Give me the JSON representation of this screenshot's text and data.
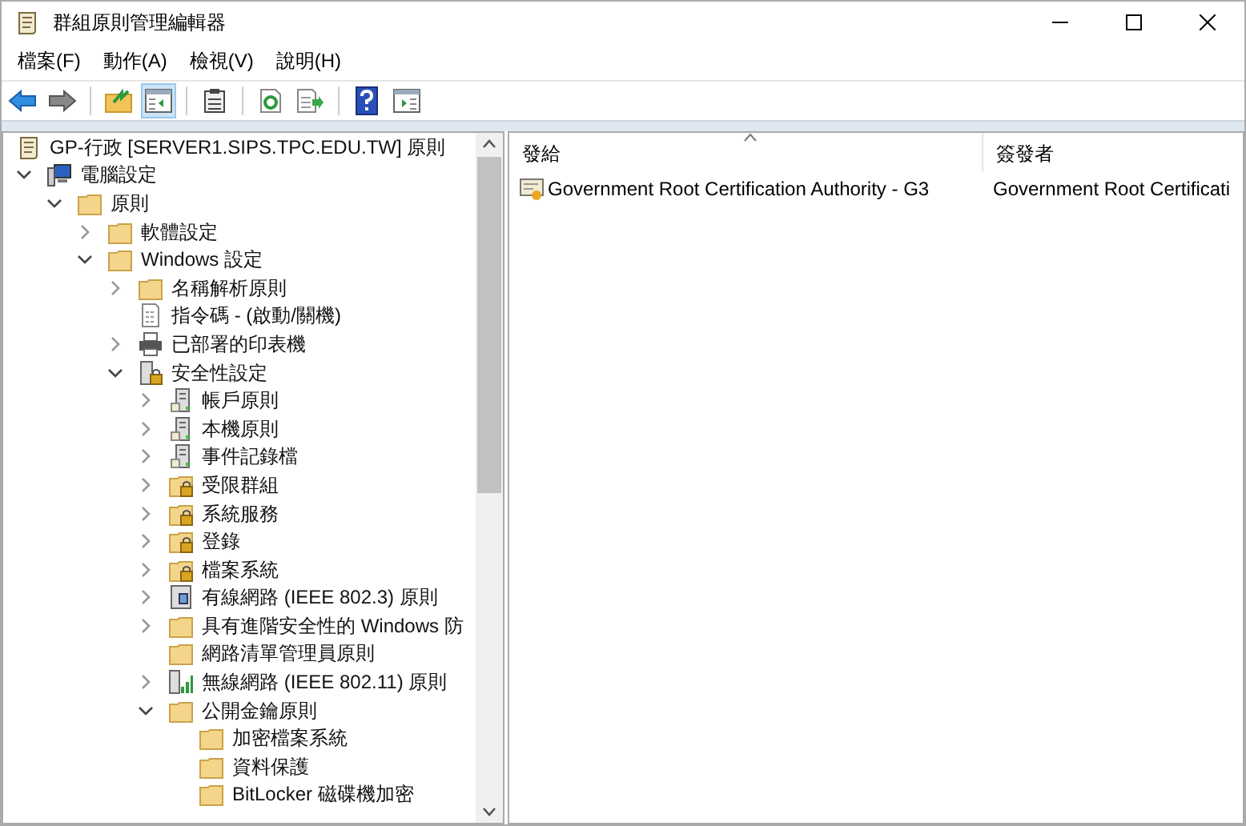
{
  "window": {
    "title": "群組原則管理編輯器"
  },
  "menu": [
    "檔案(F)",
    "動作(A)",
    "檢視(V)",
    "說明(H)"
  ],
  "toolbar": [
    {
      "kind": "back",
      "selected": false
    },
    {
      "kind": "forward",
      "selected": false
    },
    {
      "kind": "sep"
    },
    {
      "kind": "up",
      "selected": false
    },
    {
      "kind": "tree",
      "selected": true
    },
    {
      "kind": "sep"
    },
    {
      "kind": "clipboard",
      "selected": false
    },
    {
      "kind": "sep"
    },
    {
      "kind": "refresh",
      "selected": false
    },
    {
      "kind": "export",
      "selected": false
    },
    {
      "kind": "sep"
    },
    {
      "kind": "help",
      "selected": false
    },
    {
      "kind": "pane",
      "selected": false
    }
  ],
  "tree": {
    "label": "GP-行政 [SERVER1.SIPS.TPC.EDU.TW] 原則",
    "kind": "policy",
    "children": [
      {
        "label": "電腦設定",
        "kind": "computer",
        "expanded": true,
        "children": [
          {
            "label": "原則",
            "kind": "folder",
            "expanded": true,
            "children": [
              {
                "label": "軟體設定",
                "kind": "folder",
                "expanded": false
              },
              {
                "label": "Windows 設定",
                "kind": "folder",
                "expanded": true,
                "children": [
                  {
                    "label": "名稱解析原則",
                    "kind": "folder",
                    "expanded": false
                  },
                  {
                    "label": "指令碼 - (啟動/關機)",
                    "kind": "script"
                  },
                  {
                    "label": "已部署的印表機",
                    "kind": "printer",
                    "expanded": false
                  },
                  {
                    "label": "安全性設定",
                    "kind": "security",
                    "expanded": true,
                    "children": [
                      {
                        "label": "帳戶原則",
                        "kind": "server",
                        "expanded": false
                      },
                      {
                        "label": "本機原則",
                        "kind": "server",
                        "expanded": false
                      },
                      {
                        "label": "事件記錄檔",
                        "kind": "server",
                        "expanded": false
                      },
                      {
                        "label": "受限群組",
                        "kind": "lockfolder",
                        "expanded": false
                      },
                      {
                        "label": "系統服務",
                        "kind": "lockfolder",
                        "expanded": false
                      },
                      {
                        "label": "登錄",
                        "kind": "lockfolder",
                        "expanded": false
                      },
                      {
                        "label": "檔案系統",
                        "kind": "lockfolder",
                        "expanded": false
                      },
                      {
                        "label": "有線網路 (IEEE 802.3) 原則",
                        "kind": "wired",
                        "expanded": false
                      },
                      {
                        "label": "具有進階安全性的 Windows 防",
                        "kind": "folder",
                        "expanded": false
                      },
                      {
                        "label": "網路清單管理員原則",
                        "kind": "folder"
                      },
                      {
                        "label": "無線網路 (IEEE 802.11) 原則",
                        "kind": "wireless",
                        "expanded": false
                      },
                      {
                        "label": "公開金鑰原則",
                        "kind": "folder",
                        "expanded": true,
                        "children": [
                          {
                            "label": "加密檔案系統",
                            "kind": "folder"
                          },
                          {
                            "label": "資料保護",
                            "kind": "folder"
                          },
                          {
                            "label": "BitLocker 磁碟機加密",
                            "kind": "folder"
                          }
                        ]
                      }
                    ]
                  }
                ]
              }
            ]
          }
        ]
      }
    ]
  },
  "list": {
    "columns": [
      "發給",
      "簽發者"
    ],
    "rows": [
      [
        "Government Root Certification Authority - G3",
        "Government Root Certificati"
      ]
    ]
  }
}
